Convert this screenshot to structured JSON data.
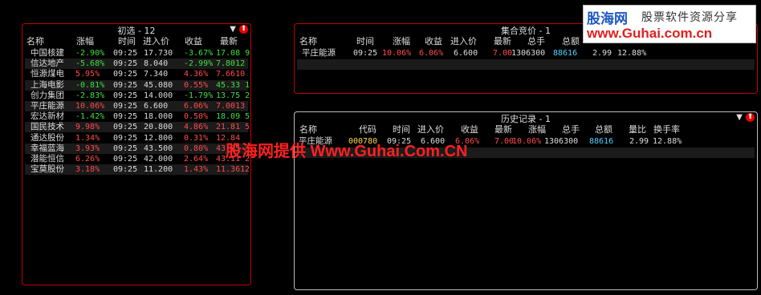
{
  "panel1": {
    "title": "初选 - 12",
    "headers": [
      "名称",
      "涨幅",
      "时间",
      "进入价",
      "收益",
      "最新"
    ],
    "rows": [
      [
        "中国核建",
        "-2.90%",
        "09:25",
        "17.730",
        "-3.67%",
        "17.08 9"
      ],
      [
        "信达地产",
        "-5.68%",
        "09:25",
        "8.040",
        "-2.99%",
        "7.8012"
      ],
      [
        "恒源煤电",
        "5.95%",
        "09:25",
        "7.340",
        "4.36%",
        "7.6610"
      ],
      [
        "上海电影",
        "-0.81%",
        "09:25",
        "45.080",
        "0.55%",
        "45.33 1"
      ],
      [
        "创力集团",
        "-2.83%",
        "09:25",
        "14.000",
        "-1.79%",
        "13.75 2"
      ],
      [
        "平庄能源",
        "10.06%",
        "09:25",
        "6.600",
        "6.06%",
        "7.0013"
      ],
      [
        "宏达新材",
        "-1.42%",
        "09:25",
        "18.000",
        "0.50%",
        "18.09 5"
      ],
      [
        "国民技术",
        "9.98%",
        "09:25",
        "20.800",
        "4.86%",
        "21.81 5"
      ],
      [
        "通达股份",
        "1.34%",
        "09:25",
        "12.800",
        "0.31%",
        "12.84"
      ],
      [
        "幸福蓝海",
        "3.93%",
        "09:25",
        "43.500",
        "0.80%",
        "43.85"
      ],
      [
        "潜能恒信",
        "6.26%",
        "09:25",
        "42.000",
        "2.64%",
        "43.11 2"
      ],
      [
        "宝莫股份",
        "3.18%",
        "09:25",
        "11.200",
        "1.43%",
        "11.3612"
      ]
    ]
  },
  "panel2": {
    "title": "集合竞价 - 1",
    "headers": [
      "名称",
      "时间",
      "涨幅",
      "收益",
      "进入价",
      "最新",
      "总手",
      "总额"
    ],
    "row": [
      "平庄能源",
      "09:25",
      "10.06%",
      "6.06%",
      "6.600",
      "7.00",
      "1306300",
      "88616",
      "2.99",
      "12.88%"
    ]
  },
  "panel3": {
    "title": "历史记录 - 1",
    "headers": [
      "名称",
      "代码",
      "时间",
      "进入价",
      "收益",
      "最新",
      "涨幅",
      "总手",
      "总额",
      "量比",
      "换手率"
    ],
    "row": [
      "平庄能源",
      "000780",
      "09:25",
      "6.600",
      "6.06%",
      "7.00",
      "10.06%",
      "1306300",
      "88616",
      "2.99",
      "12.88%"
    ]
  },
  "icons": {
    "dropdown": "▼",
    "up": "⬆"
  },
  "watermark": "股海网提供 Www.Guhai.Com.CN",
  "logo": {
    "line1a": "股海网",
    "line1b": "股票软件资源分享",
    "line2": "www.Guhai.com.cn"
  }
}
